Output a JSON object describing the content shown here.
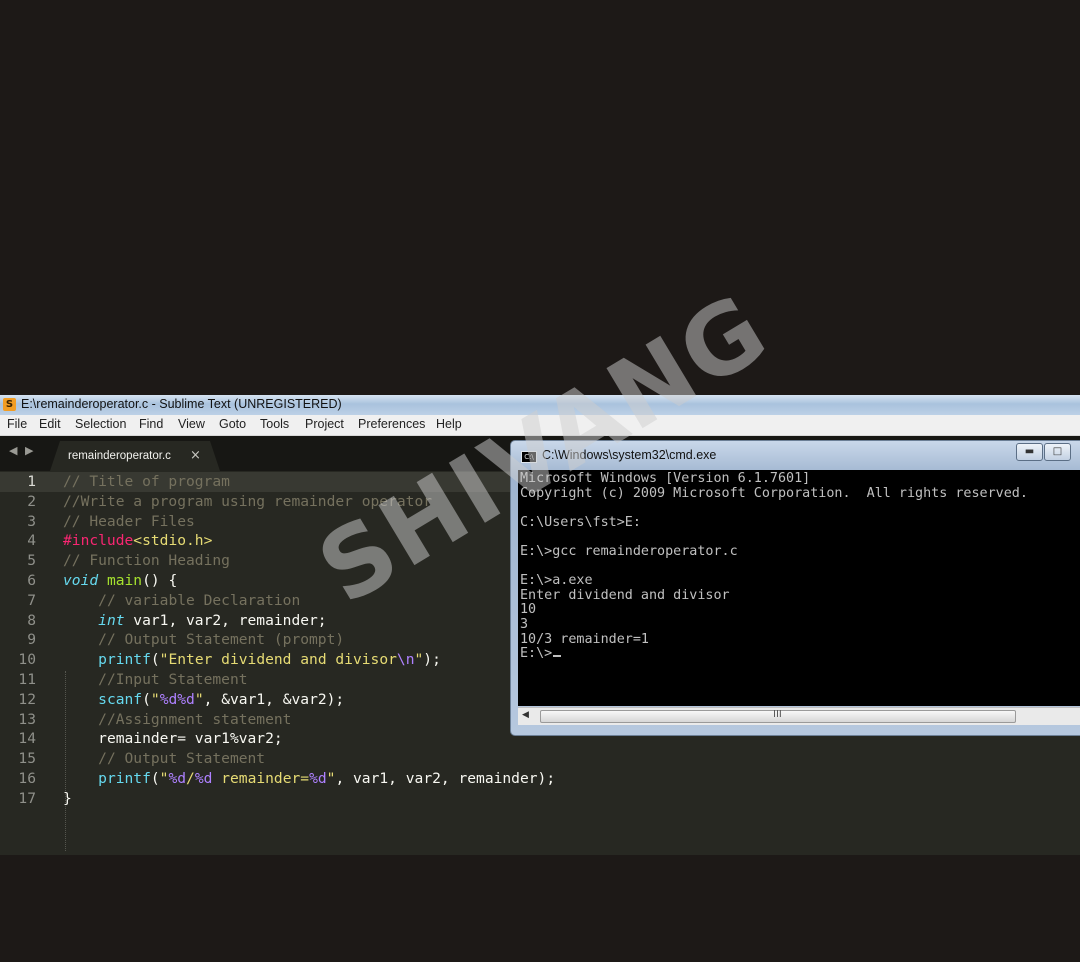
{
  "sublime": {
    "title": "E:\\remainderoperator.c - Sublime Text (UNREGISTERED)",
    "menu": [
      "File",
      "Edit",
      "Selection",
      "Find",
      "View",
      "Goto",
      "Tools",
      "Project",
      "Preferences",
      "Help"
    ],
    "tab": {
      "label": "remainderoperator.c",
      "close": "×"
    },
    "nav_arrows": "◀ ▶",
    "active_line": 1,
    "lines": [
      {
        "n": "1",
        "indent": "",
        "parts": [
          [
            "cm",
            "// Title of program"
          ]
        ]
      },
      {
        "n": "2",
        "indent": "",
        "parts": [
          [
            "cm",
            "//Write a program using remainder operator"
          ]
        ]
      },
      {
        "n": "3",
        "indent": "",
        "parts": [
          [
            "cm",
            "// Header Files"
          ]
        ]
      },
      {
        "n": "4",
        "indent": "",
        "parts": [
          [
            "kw",
            "#include"
          ],
          [
            "st",
            "<stdio.h>"
          ]
        ]
      },
      {
        "n": "5",
        "indent": "",
        "parts": [
          [
            "cm",
            "// Function Heading"
          ]
        ]
      },
      {
        "n": "6",
        "indent": "",
        "parts": [
          [
            "ty",
            "void"
          ],
          [
            "",
            " "
          ],
          [
            "fn",
            "main"
          ],
          [
            "",
            "() {"
          ]
        ]
      },
      {
        "n": "7",
        "indent": "    ",
        "parts": [
          [
            "cm",
            "// variable Declaration"
          ]
        ]
      },
      {
        "n": "8",
        "indent": "    ",
        "parts": [
          [
            "ty",
            "int"
          ],
          [
            "",
            " var1, var2, remainder;"
          ]
        ]
      },
      {
        "n": "9",
        "indent": "    ",
        "parts": [
          [
            "cm",
            "// Output Statement (prompt)"
          ]
        ]
      },
      {
        "n": "10",
        "indent": "    ",
        "parts": [
          [
            "bi",
            "printf"
          ],
          [
            "",
            "("
          ],
          [
            "st",
            "\"Enter dividend and divisor"
          ],
          [
            "ps",
            "\\n"
          ],
          [
            "st",
            "\""
          ],
          [
            "",
            ");"
          ]
        ]
      },
      {
        "n": "11",
        "indent": "    ",
        "parts": [
          [
            "cm",
            "//Input Statement"
          ]
        ]
      },
      {
        "n": "12",
        "indent": "    ",
        "parts": [
          [
            "bi",
            "scanf"
          ],
          [
            "",
            "("
          ],
          [
            "st",
            "\""
          ],
          [
            "ps",
            "%d%d"
          ],
          [
            "st",
            "\""
          ],
          [
            "",
            ", &var1, &var2);"
          ]
        ]
      },
      {
        "n": "13",
        "indent": "    ",
        "parts": [
          [
            "cm",
            "//Assignment statement"
          ]
        ]
      },
      {
        "n": "14",
        "indent": "    ",
        "parts": [
          [
            "",
            "remainder= var1%var2;"
          ]
        ]
      },
      {
        "n": "15",
        "indent": "    ",
        "parts": [
          [
            "cm",
            "// Output Statement"
          ]
        ]
      },
      {
        "n": "16",
        "indent": "    ",
        "parts": [
          [
            "bi",
            "printf"
          ],
          [
            "",
            "("
          ],
          [
            "st",
            "\""
          ],
          [
            "ps",
            "%d"
          ],
          [
            "st",
            "/"
          ],
          [
            "ps",
            "%d"
          ],
          [
            "st",
            " remainder="
          ],
          [
            "ps",
            "%d"
          ],
          [
            "st",
            "\""
          ],
          [
            "",
            ", var1, var2, remainder);"
          ]
        ]
      },
      {
        "n": "17",
        "indent": "",
        "parts": [
          [
            "",
            "}"
          ]
        ]
      }
    ]
  },
  "cmd": {
    "title": "C:\\Windows\\system32\\cmd.exe",
    "icon_label": "C:\\",
    "buttons": {
      "minimize": "▬",
      "maximize": "□"
    },
    "lines": [
      "Microsoft Windows [Version 6.1.7601]",
      "Copyright (c) 2009 Microsoft Corporation.  All rights reserved.",
      "",
      "C:\\Users\\fst>E:",
      "",
      "E:\\>gcc remainderoperator.c",
      "",
      "E:\\>a.exe",
      "Enter dividend and divisor",
      "10",
      "3",
      "10/3 remainder=1",
      "E:\\>"
    ],
    "scroll": {
      "left_arrow": "◀",
      "grip": "III"
    }
  },
  "watermark": "SHIVANG"
}
